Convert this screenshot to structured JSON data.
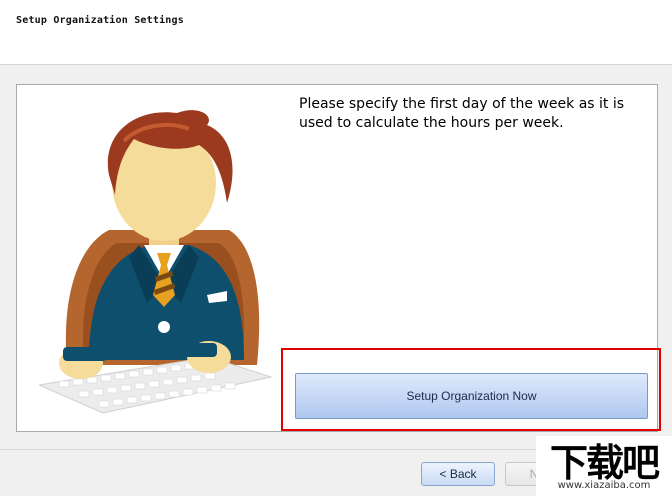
{
  "header": {
    "title": "Setup Organization Settings"
  },
  "main": {
    "message": "Please specify the first day of the week as it is used to calculate the hours per week.",
    "setup_button_label": "Setup Organization Now"
  },
  "footer": {
    "back_label": "< Back",
    "next_label": "Next"
  },
  "watermark": {
    "chars": "下载吧",
    "url": "www.xiazaiba.com"
  },
  "colors": {
    "highlight": "#e00000",
    "button_top": "#dfeafc",
    "button_bottom": "#aec7ef",
    "suit": "#0e4f6e"
  }
}
